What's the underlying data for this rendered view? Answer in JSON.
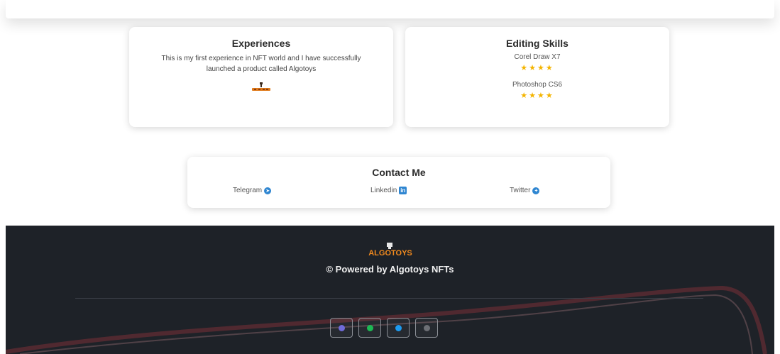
{
  "experiences": {
    "title": "Experiences",
    "text": "This is my first experience in NFT world and I have successfully launched a product called Algotoys"
  },
  "skills": {
    "title": "Editing Skills",
    "items": [
      {
        "name": "Corel Draw X7",
        "rating": 4,
        "stars": "★★★★"
      },
      {
        "name": "Photoshop CS6",
        "rating": 4,
        "stars": "★★★★"
      }
    ]
  },
  "contact": {
    "title": "Contact Me",
    "links": [
      {
        "label": "Telegram",
        "icon": "telegram-icon"
      },
      {
        "label": "Linkedin",
        "icon": "linkedin-icon"
      },
      {
        "label": "Twitter",
        "icon": "twitter-icon"
      }
    ]
  },
  "footer": {
    "logo_text": "ALGOTOYS",
    "powered_text": "© Powered by Algotoys NFTs",
    "social": [
      {
        "icon": "discord-icon",
        "color": "#6f6bd9"
      },
      {
        "icon": "spotify-icon",
        "color": "#1db954"
      },
      {
        "icon": "twitter-icon",
        "color": "#1d9bf0"
      },
      {
        "icon": "x-icon",
        "color": "#6d6f75"
      }
    ]
  },
  "colors": {
    "footer_bg": "#1e2228",
    "star": "#f4b400",
    "link_icon": "#2f86d1"
  }
}
